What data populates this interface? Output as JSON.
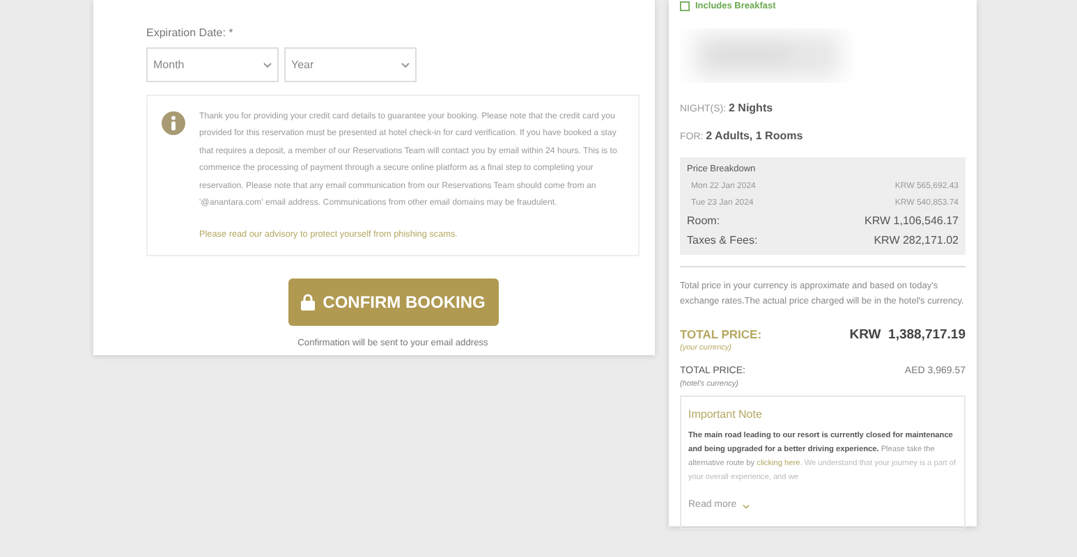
{
  "payment_form": {
    "expiration_label": "Expiration Date: *",
    "month": {
      "placeholder": "Month"
    },
    "year": {
      "placeholder": "Year"
    },
    "notice": {
      "text": "Thank you for providing your credit card details to guarantee your booking. Please note that the credit card you provided for this reservation must be presented at hotel check-in for card verification. If you have booked a stay that requires a deposit, a member of our Reservations Team will contact you by email within 24 hours. This is to commence the processing of payment through a secure online platform as a final step to completing your reservation. Please note that any email communication from our Reservations Team should come from an '@anantara.com' email address. Communications from other email domains may be fraudulent.",
      "link": "Please read our advisory to protect yourself from phishing scams."
    },
    "confirm_button": "CONFIRM BOOKING",
    "confirmation_note": "Confirmation will be sent to your email address"
  },
  "summary": {
    "includes": "Includes Breakfast",
    "nights": {
      "label": "NIGHT(S):",
      "value": "2 Nights"
    },
    "guests": {
      "label": "FOR:",
      "value": "2 Adults, 1 Rooms"
    },
    "breakdown": {
      "title": "Price Breakdown",
      "lines": [
        {
          "kind": "day",
          "label": "Mon 22 Jan 2024",
          "amount": "KRW 565,692.43"
        },
        {
          "kind": "day",
          "label": "Tue 23 Jan 2024",
          "amount": "KRW 540,853.74"
        },
        {
          "kind": "total",
          "label": "Room:",
          "amount": "KRW 1,106,546.17"
        },
        {
          "kind": "total",
          "label": "Taxes & Fees:",
          "amount": "KRW 282,171.02"
        }
      ]
    },
    "currency_note": "Total price in your currency is approximate and based on today's exchange rates.The actual price charged will be in the hotel's currency.",
    "totals": [
      {
        "kind": "primary",
        "label": "TOTAL PRICE:",
        "sublabel": "(your currency)",
        "currency": "KRW",
        "amount": "1,388,717.19"
      },
      {
        "kind": "secondary",
        "label": "TOTAL PRICE:",
        "sublabel": "(hotel's currency)",
        "currency": "AED",
        "amount": "3,969.57"
      }
    ],
    "important_note": {
      "title": "Important Note",
      "bold": "The main road leading to our resort is currently closed for maintenance and being upgraded for a better driving experience.",
      "before_link": "Please take the alternative route by",
      "link": "clicking here",
      "after_link": ". We understand that your journey is a part of your overall experience, and we",
      "read_more": "Read more"
    }
  }
}
